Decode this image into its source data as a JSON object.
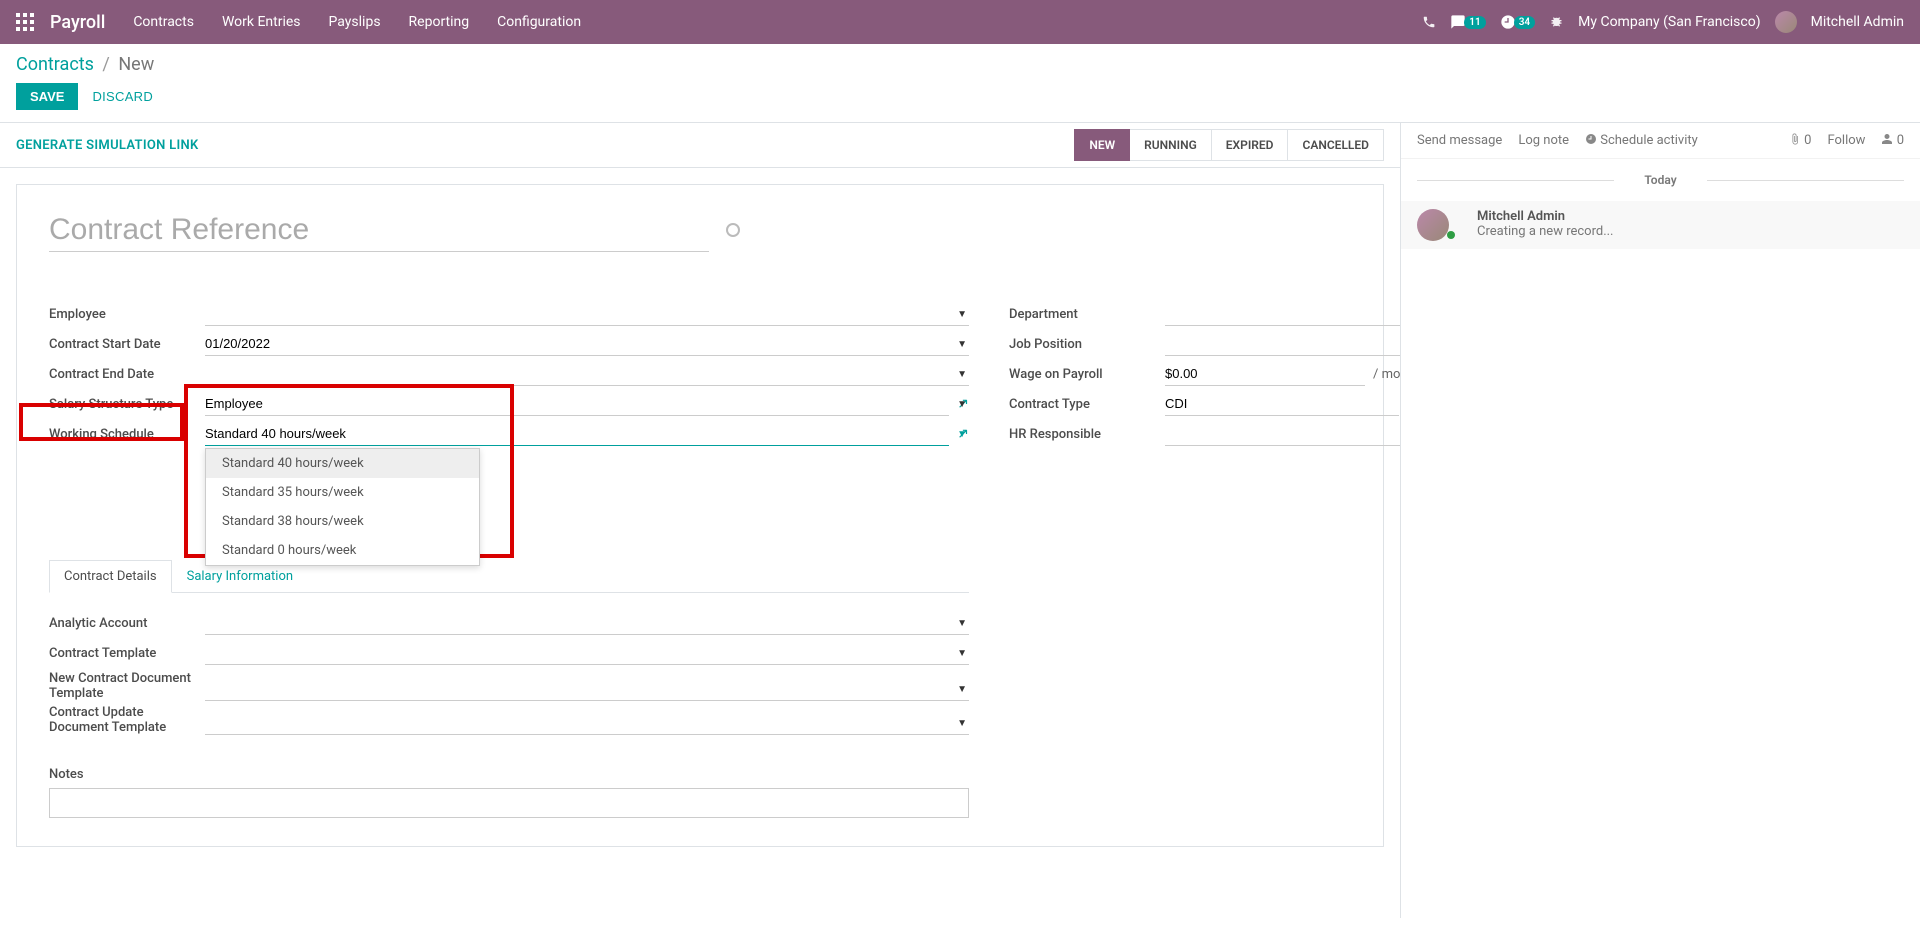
{
  "nav": {
    "brand": "Payroll",
    "links": [
      "Contracts",
      "Work Entries",
      "Payslips",
      "Reporting",
      "Configuration"
    ],
    "chat_count": "11",
    "clock_count": "34",
    "company": "My Company (San Francisco)",
    "user": "Mitchell Admin"
  },
  "breadcrumb": {
    "root": "Contracts",
    "current": "New"
  },
  "buttons": {
    "save": "SAVE",
    "discard": "DISCARD"
  },
  "statusbar": {
    "gen_link": "GENERATE SIMULATION LINK",
    "steps": [
      "NEW",
      "RUNNING",
      "EXPIRED",
      "CANCELLED"
    ]
  },
  "form": {
    "title_placeholder": "Contract Reference",
    "labels": {
      "employee": "Employee",
      "start_date": "Contract Start Date",
      "end_date": "Contract End Date",
      "structure": "Salary Structure Type",
      "schedule": "Working Schedule",
      "department": "Department",
      "job": "Job Position",
      "wage": "Wage on Payroll",
      "contract_type": "Contract Type",
      "hr_resp": "HR Responsible"
    },
    "values": {
      "start_date": "01/20/2022",
      "structure": "Employee",
      "schedule": "Standard 40 hours/week",
      "wage": "$0.00",
      "wage_suffix": "/ month",
      "contract_type": "CDI"
    },
    "schedule_options": [
      "Standard 40 hours/week",
      "Standard 35 hours/week",
      "Standard 38 hours/week",
      "Standard 0 hours/week"
    ]
  },
  "tabs": [
    "Contract Details",
    "Salary Information"
  ],
  "details": {
    "analytic": "Analytic Account",
    "template": "Contract Template",
    "new_doc": "New Contract Document Template",
    "update_doc": "Contract Update Document Template",
    "notes": "Notes"
  },
  "chat": {
    "send": "Send message",
    "log": "Log note",
    "schedule": "Schedule activity",
    "attach_count": "0",
    "follow": "Follow",
    "follower_count": "0",
    "today": "Today",
    "msg_name": "Mitchell Admin",
    "msg_body": "Creating a new record..."
  }
}
